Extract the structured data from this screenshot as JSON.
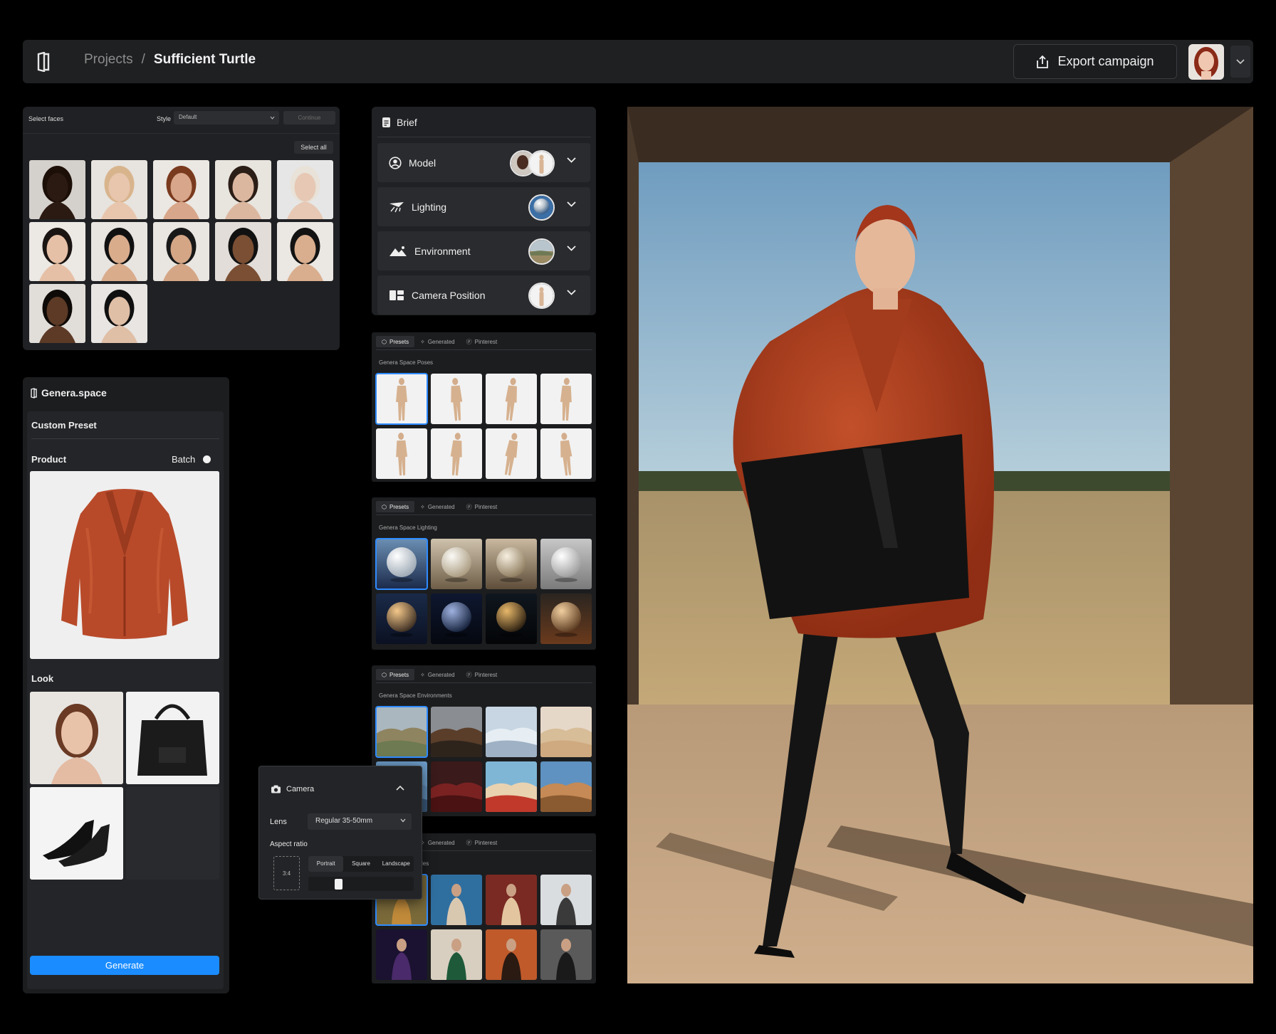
{
  "topbar": {
    "crumb_root": "Projects",
    "crumb_sep": "/",
    "crumb_current": "Sufficient Turtle",
    "export_label": "Export campaign"
  },
  "faces_panel": {
    "title": "Select faces",
    "style_label": "Style",
    "style_value": "Default",
    "continue_label": "Continue",
    "select_all_label": "Select all",
    "face_count": 12
  },
  "genera": {
    "brand": "Genera.space",
    "preset": "Custom Preset",
    "product_label": "Product",
    "batch_label": "Batch",
    "look_label": "Look",
    "generate_label": "Generate"
  },
  "brief": {
    "title": "Brief",
    "rows": [
      {
        "label": "Model"
      },
      {
        "label": "Lighting"
      },
      {
        "label": "Environment"
      },
      {
        "label": "Camera Position"
      }
    ]
  },
  "tabs": {
    "presets": "Presets",
    "generated": "Generated",
    "pinterest": "Pinterest"
  },
  "sections": {
    "poses": "Genera Space Poses",
    "lighting": "Genera Space Lighting",
    "environments": "Genera Space Environments",
    "styles_partial": "yles"
  },
  "camera": {
    "title": "Camera",
    "lens_label": "Lens",
    "lens_value": "Regular 35-50mm",
    "aspect_label": "Aspect ratio",
    "ratio_value": "3:4",
    "options": [
      "Portrait",
      "Square",
      "Landscape"
    ]
  },
  "colors": {
    "accent": "#1a8cff",
    "selected_outline": "#2f8cff",
    "panel_bg": "#202124"
  }
}
